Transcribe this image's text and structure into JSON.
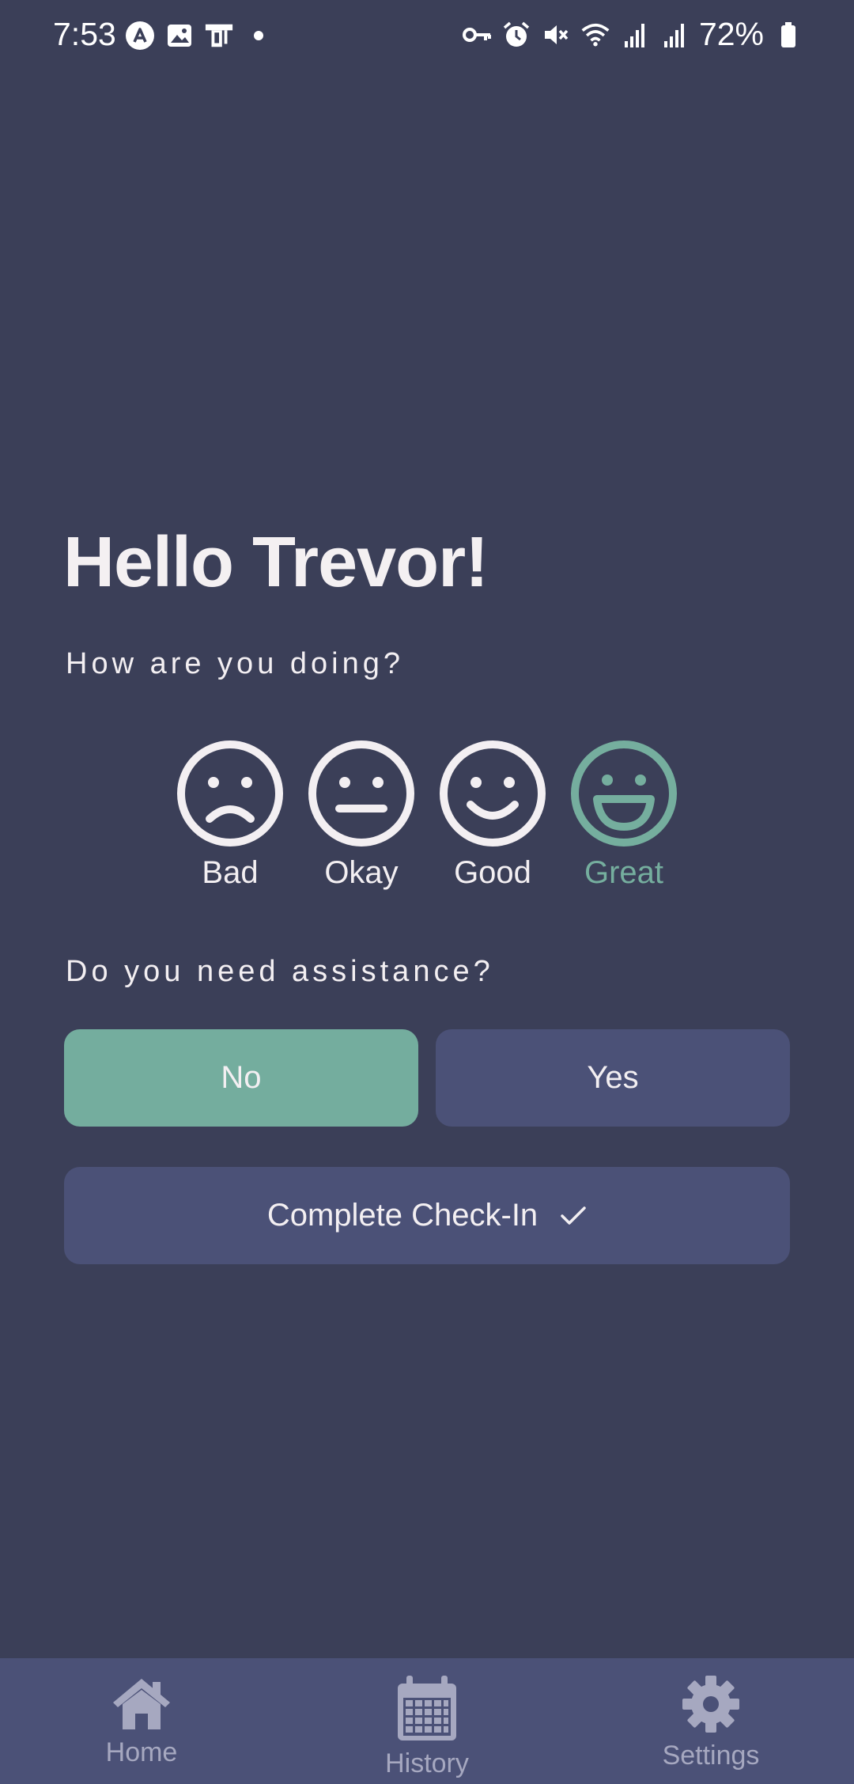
{
  "status_bar": {
    "time": "7:53",
    "battery": "72%",
    "icons": [
      "app-icon",
      "image-icon",
      "cast-icon",
      "dot-icon",
      "vpn-key-icon",
      "alarm-icon",
      "mute-icon",
      "wifi-icon",
      "signal-icon",
      "signal-icon",
      "battery-icon"
    ]
  },
  "greeting": "Hello Trevor!",
  "mood_question": "How are you doing?",
  "moods": [
    {
      "label": "Bad",
      "icon": "sad-face-icon",
      "selected": false
    },
    {
      "label": "Okay",
      "icon": "neutral-face-icon",
      "selected": false
    },
    {
      "label": "Good",
      "icon": "smile-face-icon",
      "selected": false
    },
    {
      "label": "Great",
      "icon": "grin-face-icon",
      "selected": true
    }
  ],
  "assistance_question": "Do you need assistance?",
  "assistance": {
    "no_label": "No",
    "yes_label": "Yes",
    "selected": "No"
  },
  "complete_label": "Complete Check-In",
  "nav": [
    {
      "label": "Home",
      "icon": "home-icon"
    },
    {
      "label": "History",
      "icon": "calendar-icon"
    },
    {
      "label": "Settings",
      "icon": "gear-icon"
    }
  ],
  "colors": {
    "background": "#3b3f58",
    "accent": "#74ad9e",
    "button": "#4b5177",
    "text": "#f3eff2",
    "nav_icon": "#a6a8c0"
  }
}
